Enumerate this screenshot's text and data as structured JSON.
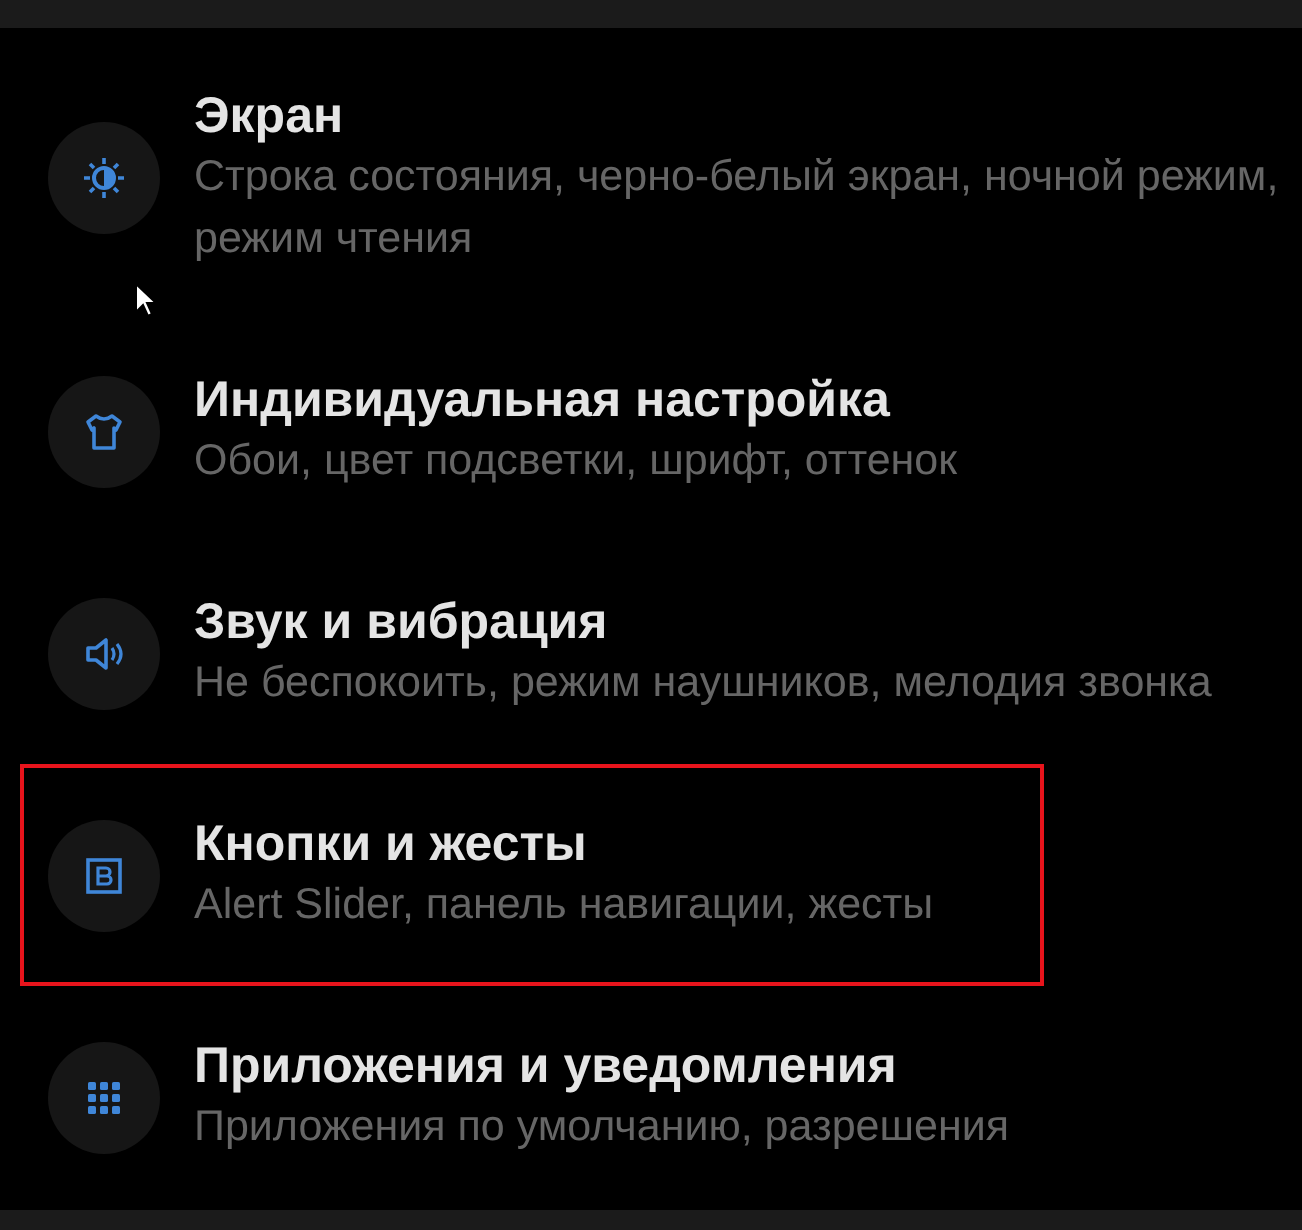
{
  "settings": [
    {
      "kind": "sun",
      "title": "Экран",
      "subtitle": "Строка состояния, черно-белый экран, ночной режим, режим чтения",
      "highlighted": false
    },
    {
      "kind": "shirt",
      "title": "Индивидуальная настройка",
      "subtitle": "Обои, цвет подсветки, шрифт, оттенок",
      "highlighted": false
    },
    {
      "kind": "speaker",
      "title": "Звук и вибрация",
      "subtitle": "Не беспокоить, режим наушников, мелодия звонка",
      "highlighted": false
    },
    {
      "kind": "button",
      "title": "Кнопки и жесты",
      "subtitle": "Alert Slider, панель навигации, жесты",
      "highlighted": true
    },
    {
      "kind": "grid",
      "title": "Приложения и уведомления",
      "subtitle": "Приложения по умолчанию, разрешения",
      "highlighted": false
    }
  ]
}
